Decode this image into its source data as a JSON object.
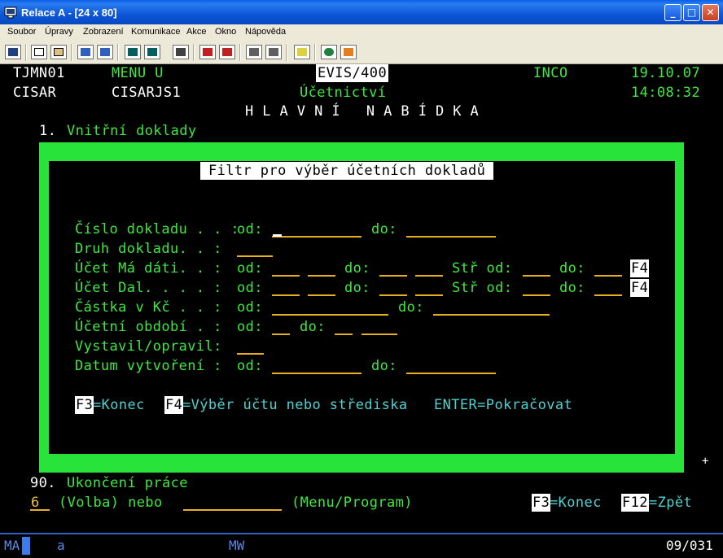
{
  "window": {
    "title": "Relace A - [24 x 80]",
    "minimize": "_",
    "maximize": "□",
    "close": "✕"
  },
  "menu": [
    "Soubor",
    "Úpravy",
    "Zobrazení",
    "Komunikace",
    "Akce",
    "Okno",
    "Nápověda"
  ],
  "toolbar": {
    "icons": [
      "print-screen",
      "copy",
      "paste",
      "send",
      "receive",
      "display",
      "display-2",
      "macro-play",
      "record",
      "stop",
      "record-2",
      "stop-2",
      "clipboard",
      "globe",
      "tools"
    ]
  },
  "header": {
    "screen_id": "TJMN01",
    "menu_name": "MENU U",
    "system": "EVIS/400",
    "company": "INCO",
    "date": "19.10.07",
    "user": "CISAR",
    "user_program": "CISARJS1",
    "module": "Účetnictví",
    "time": "14:08:32",
    "main_title": "H L A V N Í   N A B Í D K A"
  },
  "menu_options": {
    "option1_num": "1.",
    "option1_label": "Vnitřní doklady",
    "option90_num": "90.",
    "option90_label": "Ukončení práce"
  },
  "dialog": {
    "title": "Filtr pro výběr účetních dokladů",
    "fields": {
      "cislo_label": "Číslo dokladu . . :",
      "druh_label": "Druh dokladu. . :",
      "ucet_ma_label": "Účet Má dáti. . :",
      "ucet_dal_label": "Účet Dal. . . . :",
      "castka_label": "Částka v Kč . . :",
      "obdobi_label": "Účetní období . :",
      "vystavil_label": "Vystavil/opravil:",
      "datum_label": "Datum vytvoření :",
      "od": "od:",
      "do": "do:",
      "str_od": "Stř od:",
      "f4": "F4"
    },
    "keys": {
      "f3": "F3",
      "f3_label": "=Konec",
      "f4": "F4",
      "f4_label": "=Výběr účtu nebo střediska",
      "enter": "ENTER=Pokračovat"
    }
  },
  "command_line": {
    "choice_value": "6",
    "volba_label": "(Volba) nebo",
    "menu_program_label": "(Menu/Program)",
    "f3": "F3",
    "f3_label": "=Konec",
    "f12": "F12",
    "f12_label": "=Zpět"
  },
  "plus": "+",
  "status": {
    "ma": "MA",
    "session": "a",
    "mw": "MW",
    "position": "09/031"
  }
}
